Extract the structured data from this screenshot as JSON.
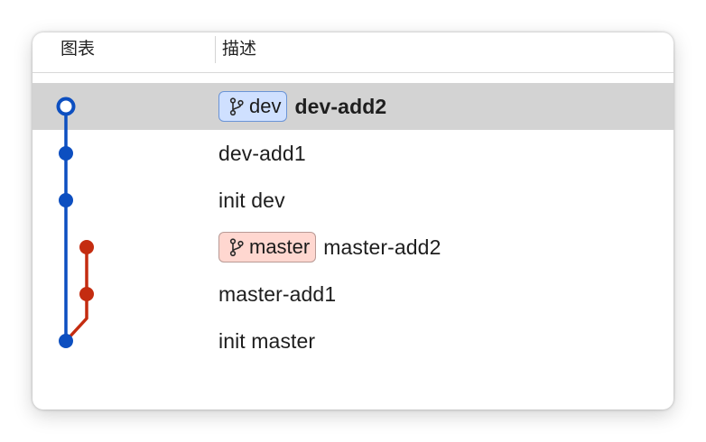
{
  "header": {
    "graph_label": "图表",
    "description_label": "描述"
  },
  "colors": {
    "dev_branch": "#0d4fc0",
    "master_branch": "#c42c10",
    "dev_badge_bg": "#cfe0ff",
    "dev_badge_border": "#6b94d6",
    "master_badge_bg": "#ffd7d0",
    "master_badge_border": "#b99a95",
    "selected_row": "#d3d3d3"
  },
  "commits": [
    {
      "message": "dev-add2",
      "branch": "dev",
      "lane": 0,
      "head": true,
      "bold": true,
      "badge": {
        "label": "dev",
        "icon": "branch-icon",
        "style": "dev"
      }
    },
    {
      "message": "dev-add1",
      "branch": "dev",
      "lane": 0
    },
    {
      "message": "init dev",
      "branch": "dev",
      "lane": 0
    },
    {
      "message": "master-add2",
      "branch": "master",
      "lane": 1,
      "badge": {
        "label": "master",
        "icon": "branch-icon",
        "style": "master"
      }
    },
    {
      "message": "master-add1",
      "branch": "master",
      "lane": 1
    },
    {
      "message": "init master",
      "branch": "dev",
      "lane": 0
    }
  ]
}
